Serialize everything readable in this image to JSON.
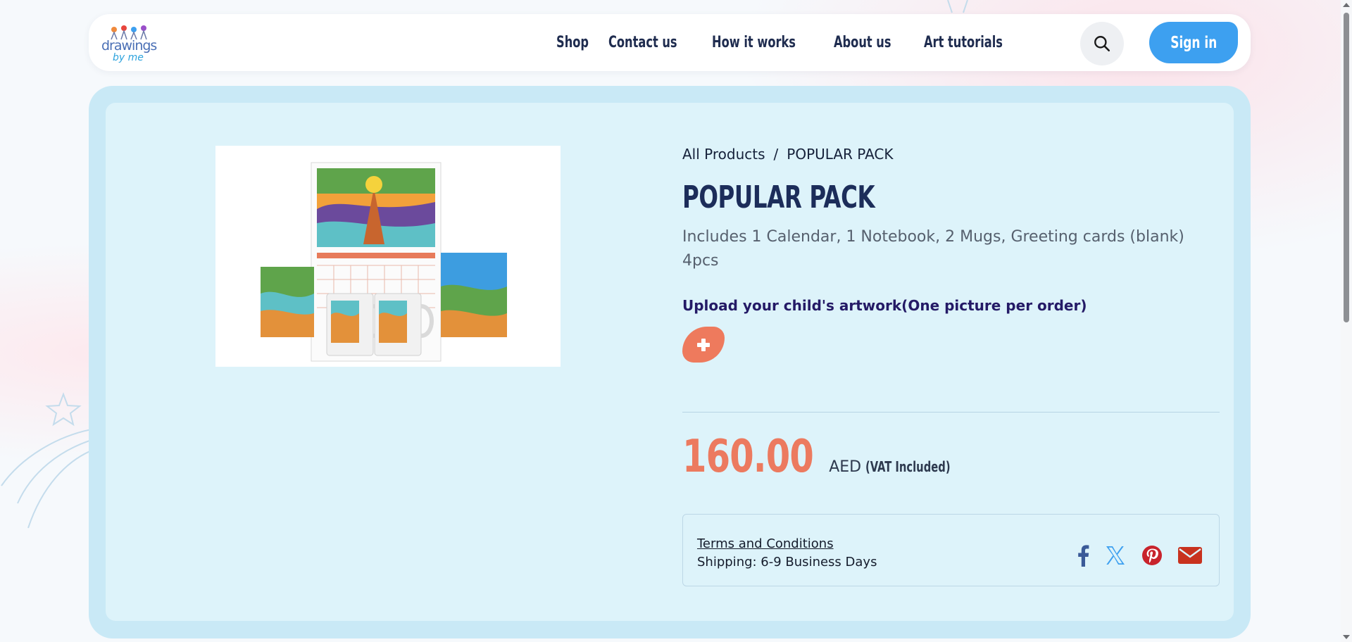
{
  "header": {
    "logo": {
      "line1": "drawings",
      "line2": "by me"
    },
    "nav": [
      {
        "label": "Shop"
      },
      {
        "label": "Contact us"
      },
      {
        "label": "How it works"
      },
      {
        "label": "About us"
      },
      {
        "label": "Art tutorials"
      }
    ],
    "search_icon": "search-icon",
    "signin_label": "Sign in"
  },
  "product": {
    "breadcrumb": {
      "parent": "All Products",
      "separator": "/",
      "current": "POPULAR PACK"
    },
    "title": "POPULAR PACK",
    "description": "Includes 1 Calendar, 1 Notebook, 2 Mugs, Greeting cards (blank) 4pcs",
    "upload_label": "Upload your child's artwork(One picture per order)",
    "upload_icon": "plus-icon",
    "price": "160.00",
    "currency": "AED",
    "vat_note": "(VAT Included)",
    "terms_label": "Terms and Conditions",
    "shipping": "Shipping: 6-9 Business Days",
    "share_icons": [
      "facebook-icon",
      "x-twitter-icon",
      "pinterest-icon",
      "email-icon"
    ]
  },
  "colors": {
    "accent": "#3da0f0",
    "price": "#ec7a5f",
    "card_outer": "#c9e9f6",
    "card_inner": "#ddf3fa",
    "title": "#1c2d5a"
  }
}
